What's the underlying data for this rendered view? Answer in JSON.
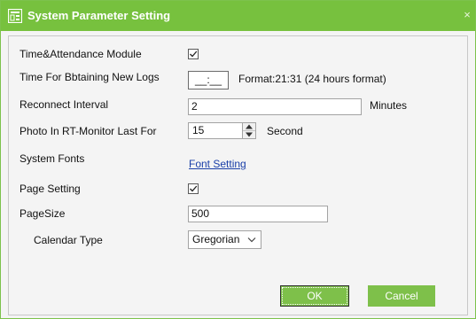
{
  "window": {
    "title": "System Parameter Setting",
    "close_symbol": "×",
    "icon": "settings-window-icon"
  },
  "fields": {
    "ta_module": {
      "label": "Time&Attendance Module",
      "checked": true
    },
    "new_logs": {
      "label": "Time For Bbtaining New Logs",
      "value": "__:__",
      "hint": "Format:21:31 (24 hours format)"
    },
    "reconnect": {
      "label": "Reconnect Interval",
      "value": "2",
      "unit": "Minutes"
    },
    "photo": {
      "label": "Photo In RT-Monitor Last For",
      "value": "15",
      "unit": "Second"
    },
    "fonts": {
      "label": "System Fonts",
      "link": "Font Setting"
    },
    "page_setting": {
      "label": "Page Setting",
      "checked": true
    },
    "page_size": {
      "label": "PageSize",
      "value": "500"
    },
    "calendar": {
      "label": "Calendar Type",
      "selected": "Gregorian"
    }
  },
  "buttons": {
    "ok": "OK",
    "cancel": "Cancel"
  },
  "colors": {
    "accent": "#77c13e",
    "button": "#7ec04a",
    "link": "#1a3fa8"
  }
}
